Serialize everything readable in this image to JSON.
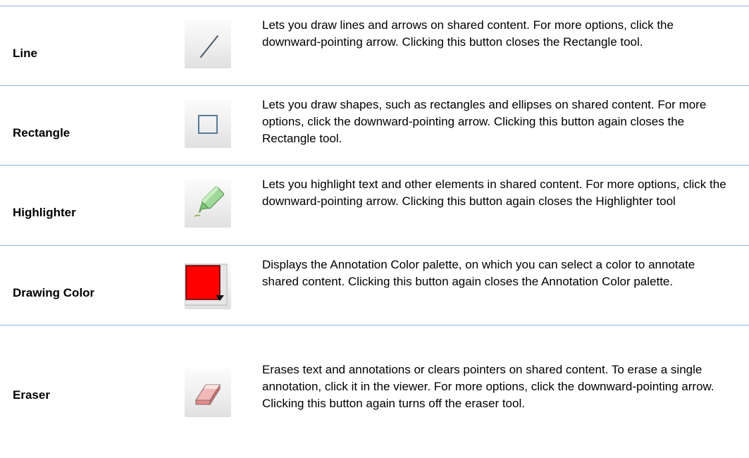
{
  "tools": [
    {
      "name": "Line",
      "icon": "line-icon",
      "description": "Lets you draw lines and arrows on shared content. For more options, click the downward-pointing arrow. Clicking this button closes the Rectangle tool."
    },
    {
      "name": "Rectangle",
      "icon": "rectangle-icon",
      "description": "Lets you draw shapes, such as rectangles and ellipses on shared content. For more options, click the downward-pointing arrow. Clicking this button again closes the Rectangle tool."
    },
    {
      "name": "Highlighter",
      "icon": "highlighter-icon",
      "description": "Lets you highlight text and other elements in shared content. For more options, click the downward-pointing arrow. Clicking this button again closes the Highlighter tool"
    },
    {
      "name": "Drawing Color",
      "icon": "drawing-color-icon",
      "description": "Displays the Annotation Color palette, on which you can select a color to annotate shared content. Clicking this button again closes the Annotation Color palette."
    },
    {
      "name": "Eraser",
      "icon": "eraser-icon",
      "description": "Erases text and annotations or clears pointers on shared content. To erase a single annotation, click it in the viewer. For more options, click the downward-pointing arrow. Clicking this button again turns off the eraser tool."
    }
  ],
  "colors": {
    "divider": "#8db3e2",
    "drawing_color": "#ff0000"
  }
}
